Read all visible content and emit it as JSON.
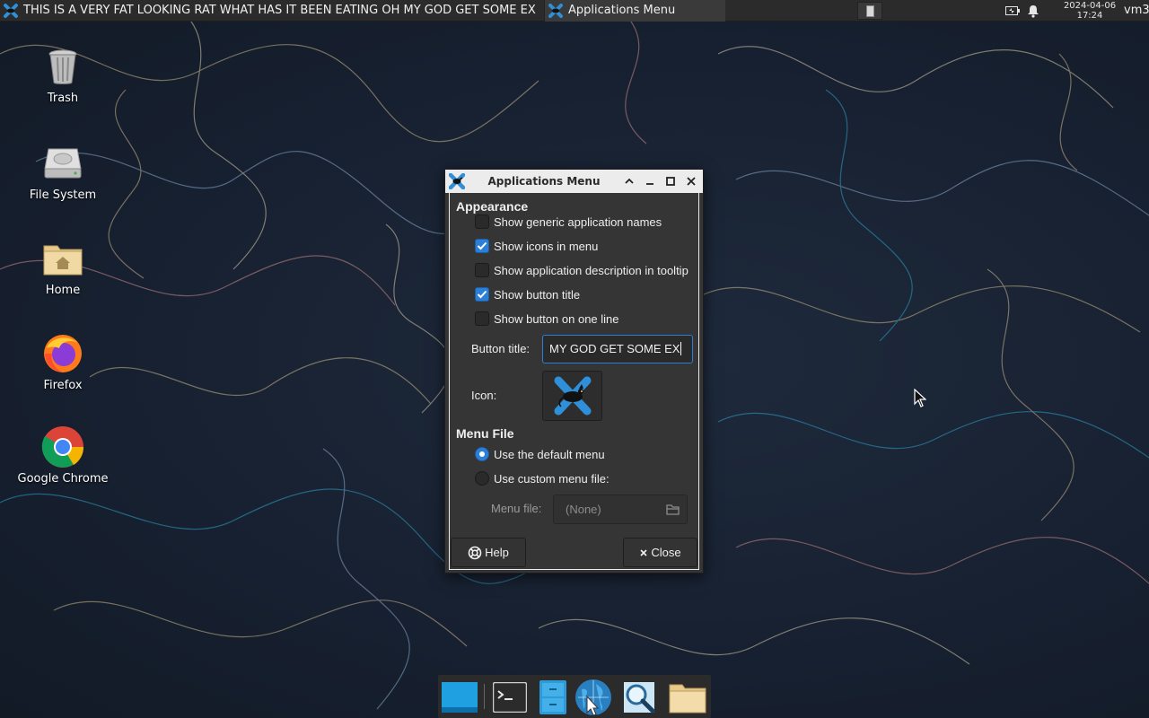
{
  "panel": {
    "tasks": [
      {
        "title": "THIS IS A VERY FAT LOOKING RAT WHAT HAS IT BEEN EATING OH MY GOD GET SOME EX"
      },
      {
        "title": "Applications Menu"
      }
    ],
    "clock": {
      "date": "2024-04-06",
      "time": "17:24"
    },
    "user": "vm3"
  },
  "desktop": {
    "icons": [
      {
        "label": "Trash"
      },
      {
        "label": "File System"
      },
      {
        "label": "Home"
      },
      {
        "label": "Firefox"
      },
      {
        "label": "Google Chrome"
      }
    ]
  },
  "dialog": {
    "title": "Applications Menu",
    "appearance": {
      "heading": "Appearance",
      "options": [
        {
          "label": "Show generic application names",
          "checked": false
        },
        {
          "label": "Show icons in menu",
          "checked": true
        },
        {
          "label": "Show application description in tooltip",
          "checked": false
        },
        {
          "label": "Show button title",
          "checked": true
        },
        {
          "label": "Show button on one line",
          "checked": false
        }
      ],
      "button_title_label": "Button title:",
      "button_title_value": "MY GOD GET SOME EX",
      "icon_label": "Icon:"
    },
    "menu_file": {
      "heading": "Menu File",
      "options": [
        {
          "label": "Use the default menu",
          "selected": true
        },
        {
          "label": "Use custom menu file:",
          "selected": false
        }
      ],
      "menu_file_label": "Menu file:",
      "menu_file_value": "(None)"
    },
    "help_label": "Help",
    "close_label": "Close"
  },
  "colors": {
    "accent": "#2c7fd6",
    "xfce_blue": "#2f8fd8"
  }
}
